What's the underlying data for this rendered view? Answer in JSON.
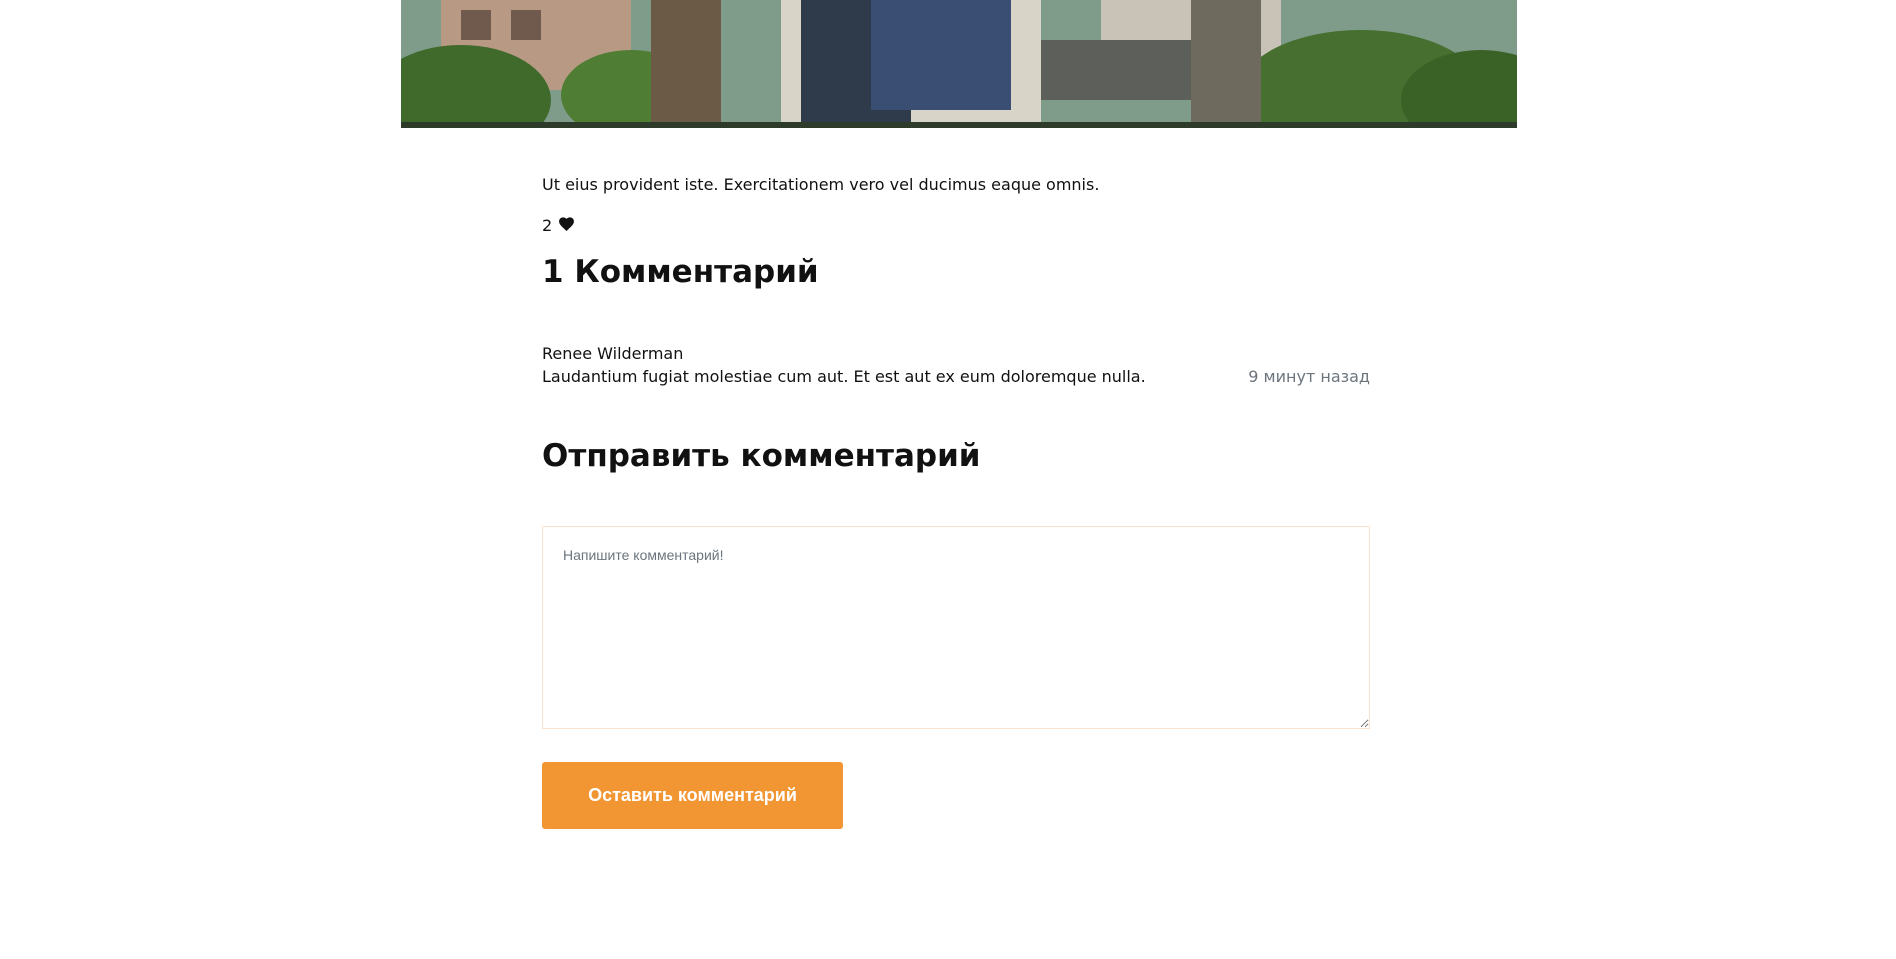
{
  "post": {
    "text": "Ut eius provident iste. Exercitationem vero vel ducimus eaque omnis.",
    "likes_count": "2",
    "like_icon": "heart-icon"
  },
  "comments": {
    "title": "1 Комментарий",
    "items": [
      {
        "author": "Renee Wilderman",
        "text": "Laudantium fugiat molestiae cum aut. Et est aut ex eum doloremque nulla.",
        "time": "9 минут назад"
      }
    ]
  },
  "comment_form": {
    "title": "Отправить комментарий",
    "placeholder": "Напишите комментарий!",
    "submit_label": "Оставить комментарий"
  },
  "colors": {
    "accent": "#f29634",
    "textarea_border": "#fbe3cf",
    "muted_text": "#6c757d"
  }
}
